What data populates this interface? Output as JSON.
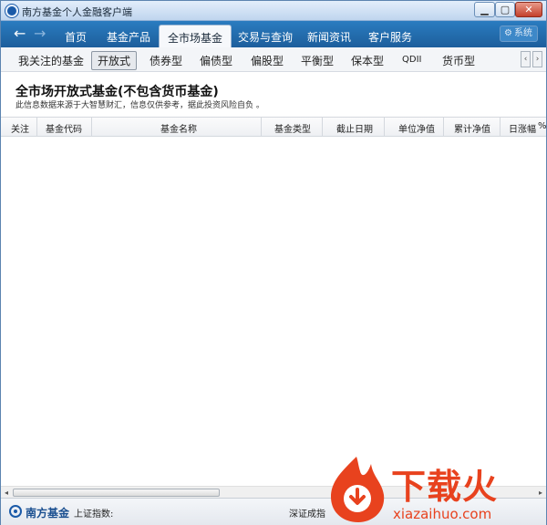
{
  "window": {
    "title": "南方基金个人金融客户端",
    "controls": {
      "minimize": "▁",
      "maximize": "▢",
      "close": "✕"
    }
  },
  "nav": {
    "back_icon": "←",
    "forward_icon": "→",
    "tabs": [
      {
        "label": "首页"
      },
      {
        "label": "基金产品"
      },
      {
        "label": "全市场基金",
        "active": true
      },
      {
        "label": "交易与查询"
      },
      {
        "label": "新闻资讯"
      },
      {
        "label": "客户服务"
      }
    ],
    "system_label": "系统",
    "system_icon": "⚙"
  },
  "subtabs": {
    "items": [
      {
        "label": "我关注的基金"
      },
      {
        "label": "开放式",
        "active": true
      },
      {
        "label": "债券型"
      },
      {
        "label": "偏债型"
      },
      {
        "label": "偏股型"
      },
      {
        "label": "平衡型"
      },
      {
        "label": "保本型"
      },
      {
        "label": "QDII"
      },
      {
        "label": "货币型"
      }
    ],
    "scroll_left": "‹",
    "scroll_right": "›"
  },
  "page": {
    "title": "全市场开放式基金(不包含货币基金)",
    "note": "此信息数据来源于大智慧财汇，信息仅供参考，据此投资风险自负 。"
  },
  "table": {
    "columns": [
      "关注",
      "基金代码",
      "基金名称",
      "基金类型",
      "截止日期",
      "单位净值",
      "累计净值",
      "日涨幅"
    ],
    "overflow_icon": "%",
    "rows": []
  },
  "hscroll": {
    "left": "◂",
    "right": "▸"
  },
  "status": {
    "brand": "南方基金",
    "sh_index_label": "上证指数:",
    "sz_index_label": "深证成指"
  },
  "watermark": {
    "text": "下载火",
    "url": "xiazaihuo.com"
  },
  "colors": {
    "nav_bg": "#1d5e9c",
    "brand": "#1a4f90",
    "watermark": "#e8421e"
  }
}
